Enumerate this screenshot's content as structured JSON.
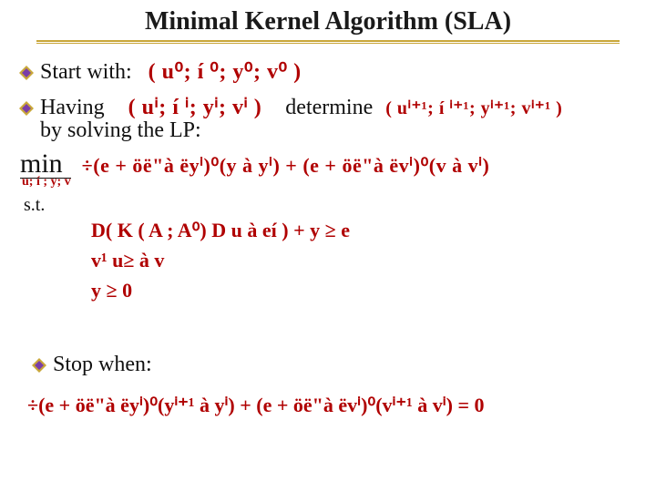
{
  "title": "Minimal Kernel Algorithm (SLA)",
  "bullet_color_outer": "#c9a73a",
  "bullet_color_inner": "#7a3ea8",
  "items": {
    "start_label": "Start with:",
    "start_formula": "( u⁰; í ⁰; y⁰; v⁰ )",
    "having_label": "Having",
    "having_formula": "( uⁱ; í ⁱ; yⁱ; vⁱ )",
    "determine_label": "determine",
    "determine_formula": "( uⁱ⁺¹; í ⁱ⁺¹; yⁱ⁺¹; vⁱ⁺¹ )",
    "by_solving": "by solving the LP:"
  },
  "lp": {
    "min_label": "min",
    "min_sub": "u; í ; y; v",
    "objective": "÷(e + öë\"à ëyⁱ)⁰(y à yⁱ) + (e + öë\"à ëvⁱ)⁰(v à vⁱ)",
    "st_label": "s.t.",
    "constraints": [
      "D( K ( A ; A⁰) D u à  eí ) + y ≥ e",
      "v¹ u≥  à  v",
      "y ≥ 0"
    ]
  },
  "stop": {
    "label": "Stop when:",
    "formula": "÷(e + öë\"à ëyⁱ)⁰(yⁱ⁺¹ à yⁱ) + (e + öë\"à ëvⁱ)⁰(vⁱ⁺¹ à vⁱ) = 0"
  }
}
